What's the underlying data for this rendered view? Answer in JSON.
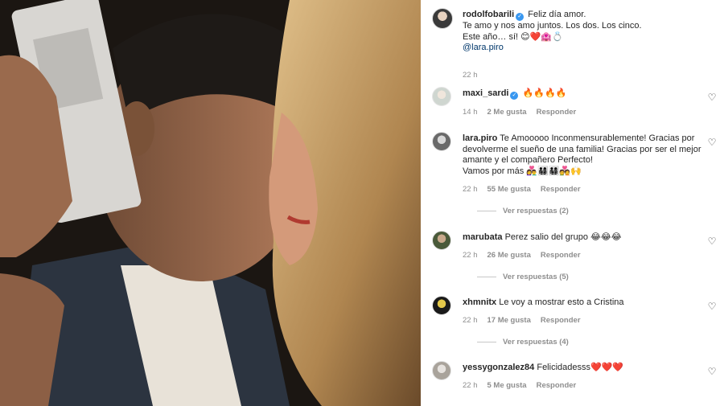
{
  "caption": {
    "username": "rodolfobarili",
    "lines": [
      "Feliz día amor.",
      "Te amo y nos amo juntos. Los dos. Los cinco.",
      "Este año… sí! 😊❤️🏩💍"
    ],
    "mention": "@lara.piro",
    "time": "22 h"
  },
  "comments": [
    {
      "username": "maxi_sardi",
      "verified": true,
      "text": "🔥🔥🔥🔥",
      "time": "14 h",
      "likes": "2 Me gusta",
      "reply": "Responder",
      "replies": ""
    },
    {
      "username": "lara.piro",
      "verified": false,
      "text": "Te Amooooo Inconmensurablemente! Gracias por devolverme el sueño de una familia! Gracias por ser el mejor amante y el compañero Perfecto!",
      "text2": "Vamos por más 👩‍❤️‍👨👨‍👩‍👧‍👦👨‍👩‍👧‍👦💑🙌",
      "time": "22 h",
      "likes": "55 Me gusta",
      "reply": "Responder",
      "replies": "Ver respuestas (2)"
    },
    {
      "username": "marubata",
      "verified": false,
      "text": "Perez salio del grupo 😂😂😂",
      "time": "22 h",
      "likes": "26 Me gusta",
      "reply": "Responder",
      "replies": "Ver respuestas (5)"
    },
    {
      "username": "xhmnitx",
      "verified": false,
      "text": "Le voy a mostrar esto a Cristina",
      "time": "22 h",
      "likes": "17 Me gusta",
      "reply": "Responder",
      "replies": "Ver respuestas (4)"
    },
    {
      "username": "yessygonzalez84",
      "verified": false,
      "text": "Felicidadesss❤️❤️❤️",
      "time": "22 h",
      "likes": "5 Me gusta",
      "reply": "Responder",
      "replies": ""
    }
  ],
  "colors": {
    "verified": "#3897f0",
    "mention": "#00376b",
    "meta": "#8e8e8e"
  },
  "icons": {
    "like": "heart-outline-icon",
    "verified": "verified-badge-icon"
  }
}
